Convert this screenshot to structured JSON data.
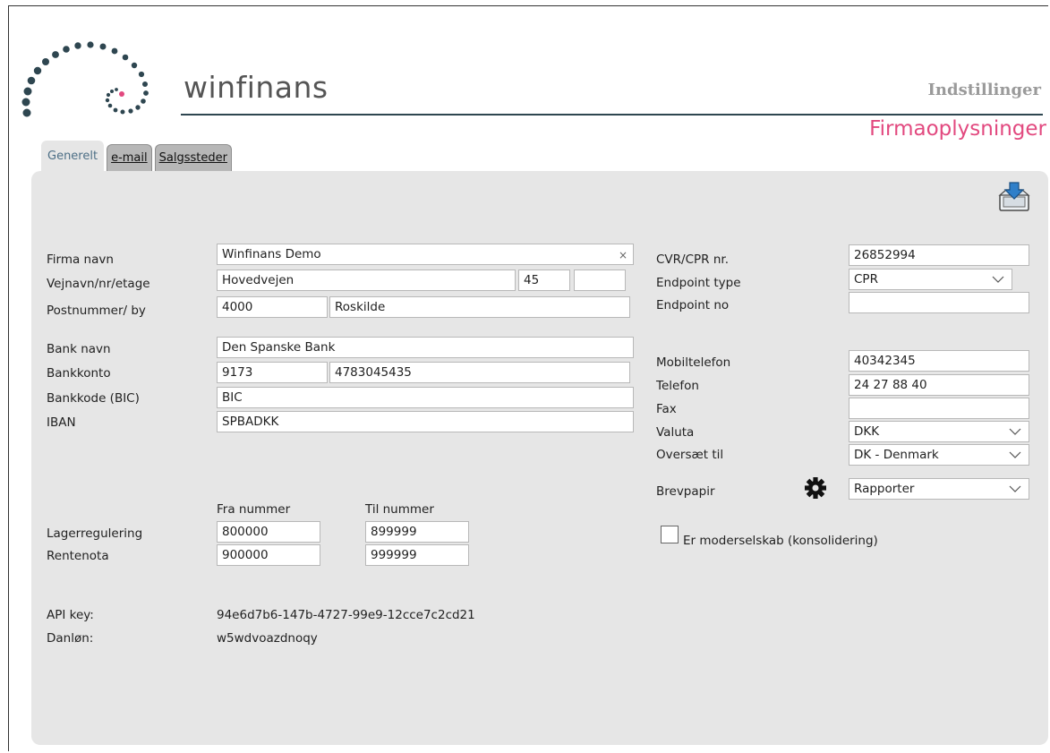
{
  "header": {
    "brand": "winfinans",
    "section": "Indstillinger",
    "title": "Firmaoplysninger"
  },
  "tabs": [
    {
      "label": "Generelt",
      "active": true
    },
    {
      "label": "e-mail",
      "active": false
    },
    {
      "label": "Salgssteder",
      "active": false
    }
  ],
  "icons": {
    "save": "save-tray-icon",
    "gear": "gear-icon",
    "chevron": "chevron-down-icon",
    "clear": "clear-icon"
  },
  "colors": {
    "accent": "#e2497f",
    "panel": "#e6e6e6",
    "logo": "#2e4650"
  },
  "left": {
    "company_name": {
      "label": "Firma navn",
      "value": "Winfinans Demo",
      "clear": "×"
    },
    "street": {
      "label": "Vejnavn/nr/etage",
      "street": "Hovedvejen",
      "number": "45",
      "floor": ""
    },
    "postal": {
      "label": "Postnummer/ by",
      "zip": "4000",
      "city": "Roskilde"
    },
    "bank_name": {
      "label": "Bank navn",
      "value": "Den Spanske Bank"
    },
    "bank_account": {
      "label": "Bankkonto",
      "reg": "9173",
      "account": "4783045435"
    },
    "bic": {
      "label": "Bankkode (BIC)",
      "value": "BIC"
    },
    "iban": {
      "label": "IBAN",
      "value": "SPBADKK"
    },
    "ranges": {
      "from_header": "Fra nummer",
      "to_header": "Til nummer",
      "rows": [
        {
          "label": "Lagerregulering",
          "from": "800000",
          "to": "899999"
        },
        {
          "label": "Rentenota",
          "from": "900000",
          "to": "999999"
        }
      ]
    },
    "api_key": {
      "label": "API key:",
      "value": "94e6d7b6-147b-4727-99e9-12cce7c2cd21"
    },
    "danlon": {
      "label": "Danløn:",
      "value": "w5wdvoazdnoqy"
    }
  },
  "right": {
    "cvr": {
      "label": "CVR/CPR nr.",
      "value": "26852994"
    },
    "endpoint_type": {
      "label": "Endpoint type",
      "value": "CPR"
    },
    "endpoint_no": {
      "label": "Endpoint no",
      "value": ""
    },
    "mobile": {
      "label": "Mobiltelefon",
      "value": "40342345"
    },
    "phone": {
      "label": "Telefon",
      "value": "24 27 88 40"
    },
    "fax": {
      "label": "Fax",
      "value": ""
    },
    "currency": {
      "label": "Valuta",
      "value": "DKK"
    },
    "translate": {
      "label": "Oversæt til",
      "value": "DK - Denmark"
    },
    "letterhead": {
      "label": "Brevpapir",
      "value": "Rapporter"
    },
    "parent_company": {
      "label": "Er moderselskab (konsolidering)",
      "checked": false
    }
  }
}
